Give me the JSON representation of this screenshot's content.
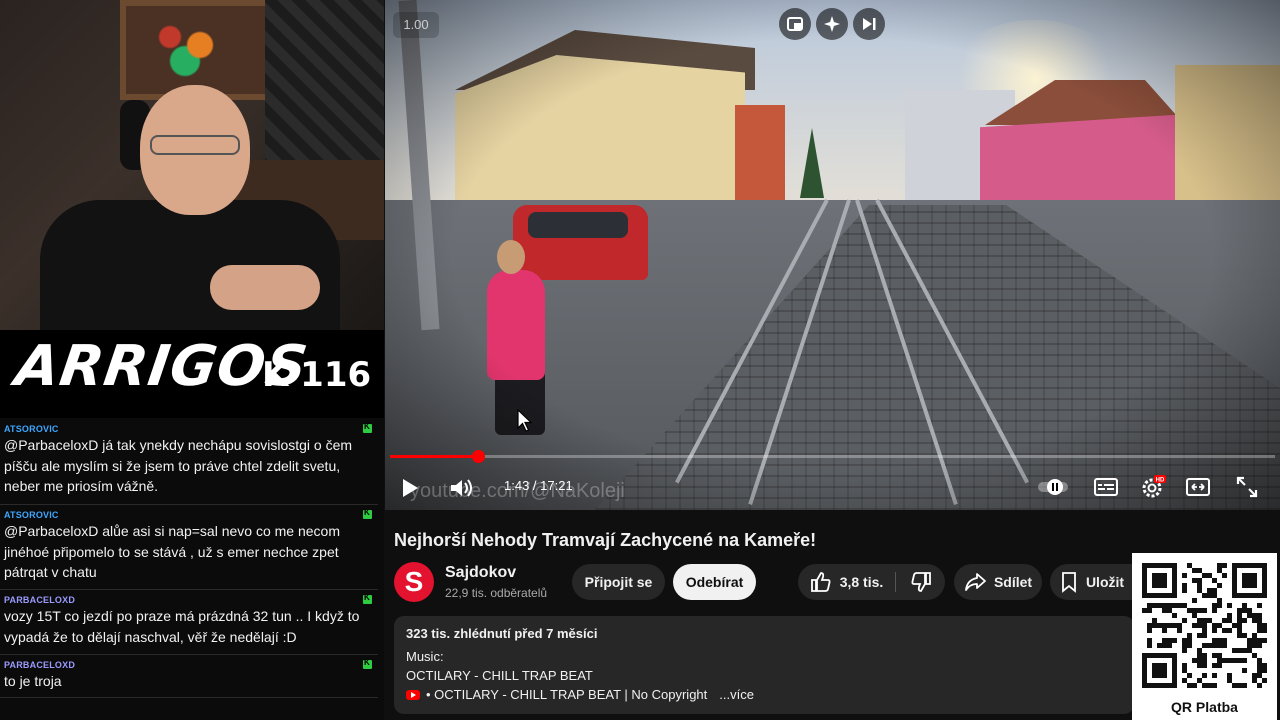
{
  "stream": {
    "brand_name": "ARRIGOS",
    "brand_number": "K 116",
    "chat": [
      {
        "user": "ATSOROVIC",
        "user_color": "#3ea6ff",
        "text": "@ParbaceloxD já tak ynekdy nechápu sovislostgi o čem píšču ale myslím si že jsem to práve chtel zdelit svetu, neber me priosím vážně."
      },
      {
        "user": "ATSOROVIC",
        "user_color": "#3ea6ff",
        "text": "@ParbaceloxD alůe asi si nap=sal nevo co me necom jinéhoé připomelo to se stává , už s emer nechce zpet pátrqat v chatu"
      },
      {
        "user": "PARBACELOXD",
        "user_color": "#9b9bff",
        "text": "vozy 15T co jezdí po praze má prázdná 32 tun .. I když to vypadá že to dělají naschval, věř že nedělají :D"
      },
      {
        "user": "PARBACELOXD",
        "user_color": "#9b9bff",
        "text": "to je troja"
      }
    ]
  },
  "player": {
    "speed_label": "1.00",
    "watermark": "youtube.com/@NaKoleji",
    "time_current": "1:43",
    "time_total": "17:21",
    "progress": 0.099,
    "top_buttons": [
      "miniplayer-icon",
      "sparkle-icon",
      "skip-next-icon"
    ],
    "controls": [
      "play-icon",
      "volume-icon",
      "autoplay-toggle",
      "subtitles-icon",
      "settings-icon",
      "theater-icon",
      "fullscreen-icon"
    ],
    "settings_badge": "HD"
  },
  "video": {
    "title": "Nejhorší Nehody Tramvají Zachycené na Kameře!",
    "channel": {
      "avatar_letter": "S",
      "name": "Sajdokov",
      "subscribers": "22,9 tis. odběratelů"
    },
    "join_label": "Připojit se",
    "subscribe_label": "Odebírat",
    "likes": "3,8 tis.",
    "share_label": "Sdílet",
    "save_label": "Uložit",
    "description": {
      "meta": "323 tis. zhlédnutí  před 7 měsíci",
      "line1": "Music:",
      "line2": "OCTILARY - CHILL TRAP BEAT",
      "link_text": "• OCTILARY - CHILL TRAP BEAT | No Copyright",
      "more_label": "...více"
    }
  },
  "qr": {
    "label": "QR Platba"
  },
  "colors": {
    "accent_red": "#ff0000",
    "background": "#0f0f0f",
    "pill": "#272727"
  }
}
